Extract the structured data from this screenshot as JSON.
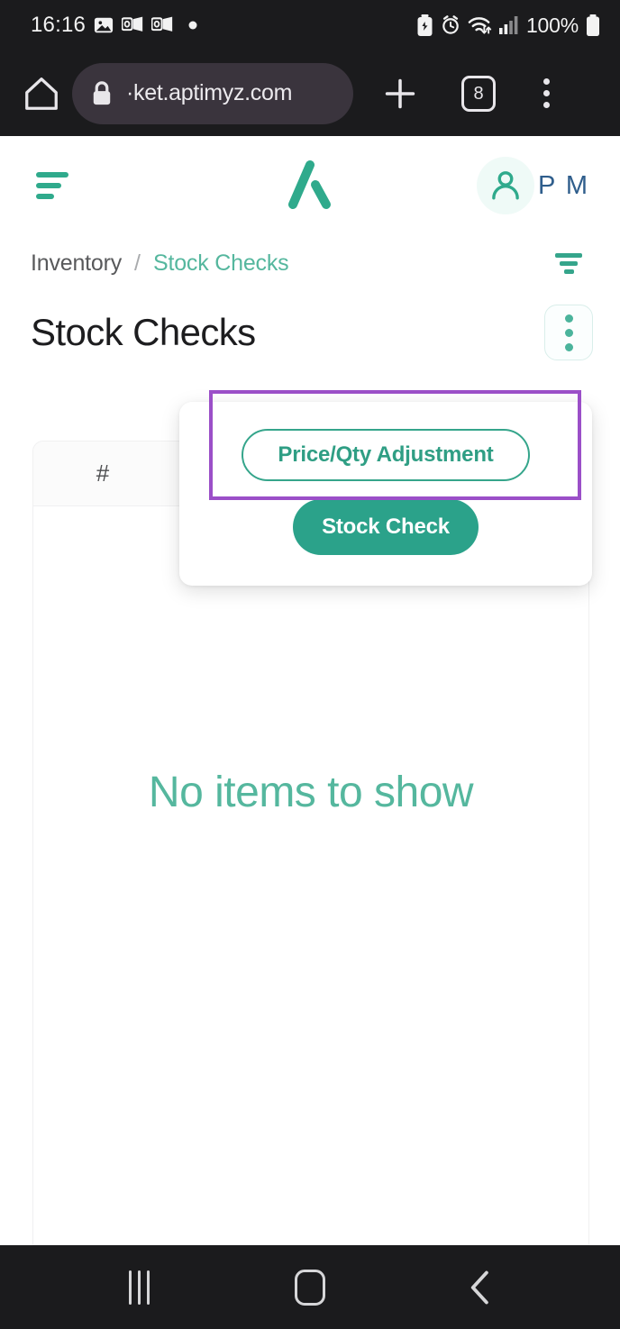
{
  "status_bar": {
    "time": "16:16",
    "left_icons": [
      "gallery-icon",
      "outlook-icon",
      "outlook-icon",
      "dot-icon"
    ],
    "right_icons": [
      "battery-saver-icon",
      "alarm-icon",
      "wifi-icon",
      "signal-icon"
    ],
    "battery_percent": "100%"
  },
  "browser": {
    "home_icon": "home-icon",
    "lock_icon": "lock-icon",
    "url": "·ket.aptimyz.com",
    "new_tab_icon": "plus-icon",
    "tab_count": "8",
    "menu_icon": "kebab-icon"
  },
  "app_header": {
    "menu_icon": "hamburger-icon",
    "logo": "aptimyz-logo",
    "avatar_icon": "user-icon",
    "user_initials": "P M"
  },
  "breadcrumb": {
    "parent": "Inventory",
    "separator": "/",
    "current": "Stock Checks",
    "filter_icon": "filter-icon"
  },
  "page": {
    "title": "Stock Checks",
    "actions_icon": "kebab-icon"
  },
  "dropdown": {
    "price_qty_label": "Price/Qty Adjustment",
    "stock_check_label": "Stock Check"
  },
  "table": {
    "columns": [
      "#"
    ],
    "rows": [],
    "empty_message": "No items to show"
  },
  "nav_bar": {
    "recents_icon": "recents-icon",
    "home_icon": "home-square-icon",
    "back_icon": "chevron-left-icon"
  },
  "colors": {
    "brand_teal": "#2ba28a",
    "accent_teal_light": "#55b79e",
    "annotation_purple": "#9b4fc8",
    "initials_blue": "#2f5e8c",
    "chrome_dark": "#1b1b1d"
  }
}
